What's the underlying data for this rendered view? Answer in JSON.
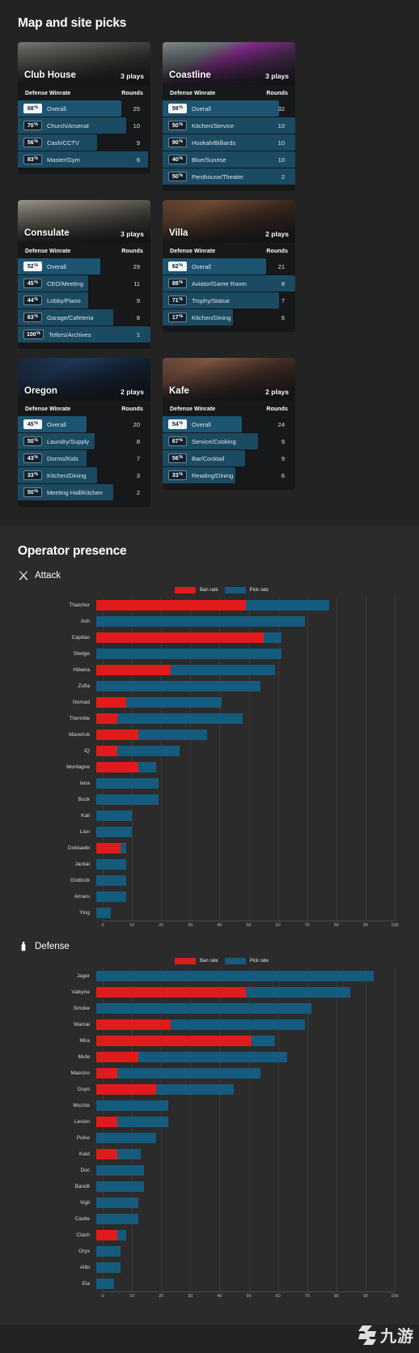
{
  "maps_section": {
    "title": "Map and site picks",
    "column_headers": {
      "winrate": "Defense Winrate",
      "rounds": "Rounds"
    },
    "plays_unit": "plays",
    "cards": [
      {
        "name": "Club House",
        "plays": "3 plays",
        "art": "clubhouse",
        "rows": [
          {
            "pct": "68",
            "unit": "%",
            "label": "Overall",
            "rounds": "25",
            "overall": true,
            "width": 78
          },
          {
            "pct": "70",
            "unit": "%",
            "label": "Church/Arsenal",
            "rounds": "10",
            "overall": false,
            "width": 82
          },
          {
            "pct": "56",
            "unit": "%",
            "label": "Cash/CCTV",
            "rounds": "9",
            "overall": false,
            "width": 60
          },
          {
            "pct": "83",
            "unit": "%",
            "label": "Master/Gym",
            "rounds": "6",
            "overall": false,
            "width": 98
          }
        ]
      },
      {
        "name": "Coastline",
        "plays": "3 plays",
        "art": "coastline",
        "rows": [
          {
            "pct": "59",
            "unit": "%",
            "label": "Overall",
            "rounds": "32",
            "overall": true,
            "width": 88
          },
          {
            "pct": "50",
            "unit": "%",
            "label": "Kitchen/Service",
            "rounds": "10",
            "overall": false,
            "width": 100
          },
          {
            "pct": "90",
            "unit": "%",
            "label": "Hookah/Billiards",
            "rounds": "10",
            "overall": false,
            "width": 100
          },
          {
            "pct": "40",
            "unit": "%",
            "label": "Blue/Sunrise",
            "rounds": "10",
            "overall": false,
            "width": 100
          },
          {
            "pct": "50",
            "unit": "%",
            "label": "Penthouse/Theater",
            "rounds": "2",
            "overall": false,
            "width": 100
          }
        ]
      },
      {
        "name": "Consulate",
        "plays": "3 plays",
        "art": "consulate",
        "rows": [
          {
            "pct": "52",
            "unit": "%",
            "label": "Overall",
            "rounds": "29",
            "overall": true,
            "width": 62
          },
          {
            "pct": "45",
            "unit": "%",
            "label": "CEO/Meeting",
            "rounds": "11",
            "overall": false,
            "width": 53
          },
          {
            "pct": "44",
            "unit": "%",
            "label": "Lobby/Piano",
            "rounds": "9",
            "overall": false,
            "width": 53
          },
          {
            "pct": "63",
            "unit": "%",
            "label": "Garage/Cafeteria",
            "rounds": "8",
            "overall": false,
            "width": 72
          },
          {
            "pct": "100",
            "unit": "%",
            "label": "Tellers/Archives",
            "rounds": "1",
            "overall": false,
            "width": 100
          }
        ]
      },
      {
        "name": "Villa",
        "plays": "2 plays",
        "art": "villa",
        "rows": [
          {
            "pct": "62",
            "unit": "%",
            "label": "Overall",
            "rounds": "21",
            "overall": true,
            "width": 78
          },
          {
            "pct": "88",
            "unit": "%",
            "label": "Aviator/Game Room",
            "rounds": "8",
            "overall": false,
            "width": 100
          },
          {
            "pct": "71",
            "unit": "%",
            "label": "Trophy/Statue",
            "rounds": "7",
            "overall": false,
            "width": 88
          },
          {
            "pct": "17",
            "unit": "%",
            "label": "Kitchen/Dining",
            "rounds": "6",
            "overall": false,
            "width": 53
          }
        ]
      },
      {
        "name": "Oregon",
        "plays": "2 plays",
        "art": "oregon",
        "rows": [
          {
            "pct": "45",
            "unit": "%",
            "label": "Overall",
            "rounds": "20",
            "overall": true,
            "width": 52
          },
          {
            "pct": "50",
            "unit": "%",
            "label": "Laundry/Supply",
            "rounds": "8",
            "overall": false,
            "width": 58
          },
          {
            "pct": "43",
            "unit": "%",
            "label": "Dorms/Kids",
            "rounds": "7",
            "overall": false,
            "width": 52
          },
          {
            "pct": "33",
            "unit": "%",
            "label": "Kitchen/Dining",
            "rounds": "3",
            "overall": false,
            "width": 60
          },
          {
            "pct": "50",
            "unit": "%",
            "label": "Meeting Hall/Kitchen",
            "rounds": "2",
            "overall": false,
            "width": 72
          }
        ]
      },
      {
        "name": "Kafe",
        "plays": "2 plays",
        "art": "kafe",
        "rows": [
          {
            "pct": "54",
            "unit": "%",
            "label": "Overall",
            "rounds": "24",
            "overall": true,
            "width": 60
          },
          {
            "pct": "67",
            "unit": "%",
            "label": "Service/Cooking",
            "rounds": "9",
            "overall": false,
            "width": 72
          },
          {
            "pct": "56",
            "unit": "%",
            "label": "Bar/Cocktail",
            "rounds": "9",
            "overall": false,
            "width": 62
          },
          {
            "pct": "33",
            "unit": "%",
            "label": "Reading/Dining",
            "rounds": "6",
            "overall": false,
            "width": 55
          }
        ]
      }
    ]
  },
  "operator_presence": {
    "title": "Operator presence",
    "legend": {
      "ban_label": "Ban rate",
      "pick_label": "Pick rate",
      "ban_color": "#e01b1b",
      "pick_color": "#155b7d"
    },
    "attack": {
      "label": "Attack",
      "icon": "swords-icon"
    },
    "defense": {
      "label": "Defense",
      "icon": "shield-icon"
    }
  },
  "chart_data": [
    {
      "type": "bar",
      "title": "Attack",
      "orientation": "horizontal",
      "stacked": true,
      "xlabel": "",
      "ylabel": "",
      "xlim": [
        0,
        100
      ],
      "grid": true,
      "legend": "top",
      "ticks": [
        "0",
        "10",
        "20",
        "30",
        "40",
        "50",
        "60",
        "70",
        "80",
        "90",
        "100"
      ],
      "categories": [
        "Thatcher",
        "Ash",
        "Capitao",
        "Sledge",
        "Hibana",
        "Zofia",
        "Nomad",
        "Thermite",
        "Maverick",
        "IQ",
        "Montagne",
        "Iana",
        "Buck",
        "Kali",
        "Lion",
        "Dokkaebi",
        "Jackal",
        "Gridlock",
        "Amaru",
        "Ying"
      ],
      "series": [
        {
          "name": "Ban rate",
          "color": "#e01b1b",
          "values": [
            50,
            0,
            56,
            0,
            25,
            0,
            10,
            7,
            14,
            7,
            14,
            0,
            0,
            0,
            0,
            8,
            0,
            0,
            0,
            0
          ]
        },
        {
          "name": "Pick rate",
          "color": "#155b7d",
          "values": [
            28,
            70,
            6,
            62,
            35,
            55,
            32,
            42,
            23,
            21,
            6,
            21,
            21,
            12,
            12,
            2,
            10,
            10,
            10,
            5
          ]
        }
      ]
    },
    {
      "type": "bar",
      "title": "Defense",
      "orientation": "horizontal",
      "stacked": true,
      "xlabel": "",
      "ylabel": "",
      "xlim": [
        0,
        100
      ],
      "grid": true,
      "legend": "top",
      "ticks": [
        "0",
        "10",
        "20",
        "30",
        "40",
        "50",
        "60",
        "70",
        "80",
        "90",
        "100"
      ],
      "categories": [
        "Jager",
        "Valkyrie",
        "Smoke",
        "Wamai",
        "Mira",
        "Mute",
        "Maestro",
        "Goyo",
        "Mozzie",
        "Lesion",
        "Pulse",
        "Kaid",
        "Doc",
        "Bandit",
        "Vigil",
        "Castle",
        "Clash",
        "Oryx",
        "Alibi",
        "Ela"
      ],
      "series": [
        {
          "name": "Ban rate",
          "color": "#e01b1b",
          "values": [
            0,
            50,
            0,
            25,
            52,
            14,
            7,
            20,
            0,
            7,
            0,
            7,
            0,
            0,
            0,
            0,
            7,
            0,
            0,
            0
          ]
        },
        {
          "name": "Pick rate",
          "color": "#155b7d",
          "values": [
            93,
            35,
            72,
            45,
            8,
            50,
            48,
            26,
            24,
            17,
            20,
            8,
            16,
            16,
            14,
            14,
            3,
            8,
            8,
            6
          ]
        }
      ]
    }
  ],
  "watermark": {
    "text": "九游"
  }
}
